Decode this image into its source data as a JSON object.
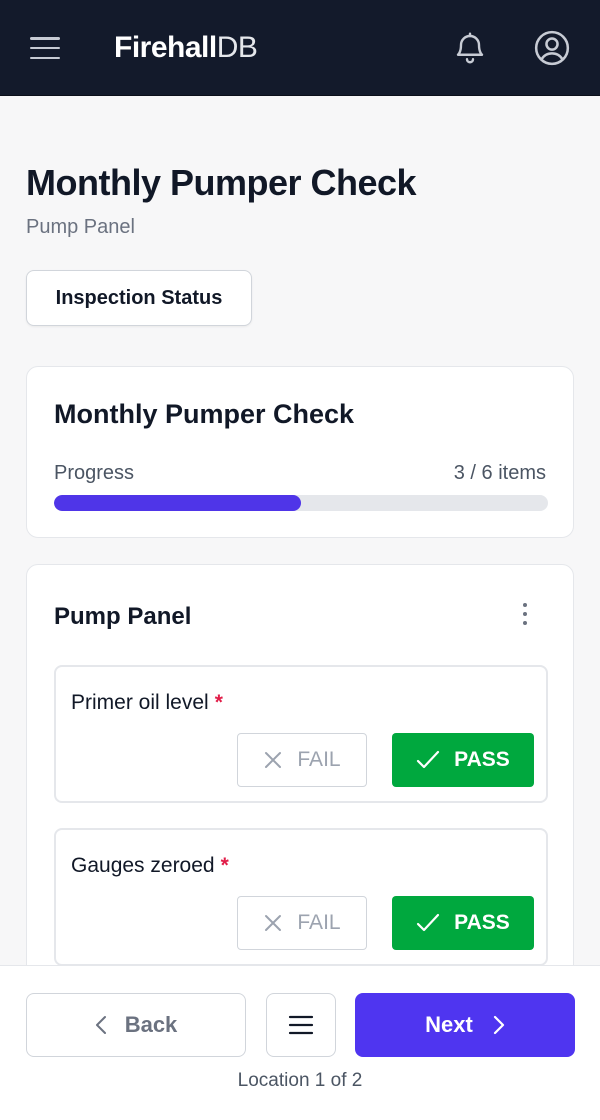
{
  "app": {
    "logo_bold": "Firehall",
    "logo_thin": "DB"
  },
  "page": {
    "title": "Monthly Pumper Check",
    "subtitle": "Pump Panel",
    "status_button": "Inspection Status"
  },
  "progress": {
    "title": "Monthly Pumper Check",
    "label": "Progress",
    "count_text": "3 / 6 items",
    "completed": 3,
    "total": 6,
    "bar_color": "#4f35e8"
  },
  "section": {
    "title": "Pump Panel",
    "items": [
      {
        "label": "Primer oil level",
        "required": "*",
        "fail_label": "FAIL",
        "pass_label": "PASS",
        "state": "pass"
      },
      {
        "label": "Gauges zeroed",
        "required": "*",
        "fail_label": "FAIL",
        "pass_label": "PASS",
        "state": "pass"
      }
    ]
  },
  "footer": {
    "back_label": "Back",
    "next_label": "Next",
    "location_text": "Location 1 of 2"
  },
  "colors": {
    "header_bg": "#131a2b",
    "pass_green": "#00a83e",
    "primary": "#4f35f0",
    "required_red": "#e11d48"
  },
  "icons": [
    "hamburger-icon",
    "bell-icon",
    "user-circle-icon",
    "kebab-icon",
    "x-icon",
    "check-icon",
    "chevron-left-icon",
    "menu-icon",
    "chevron-right-icon"
  ]
}
